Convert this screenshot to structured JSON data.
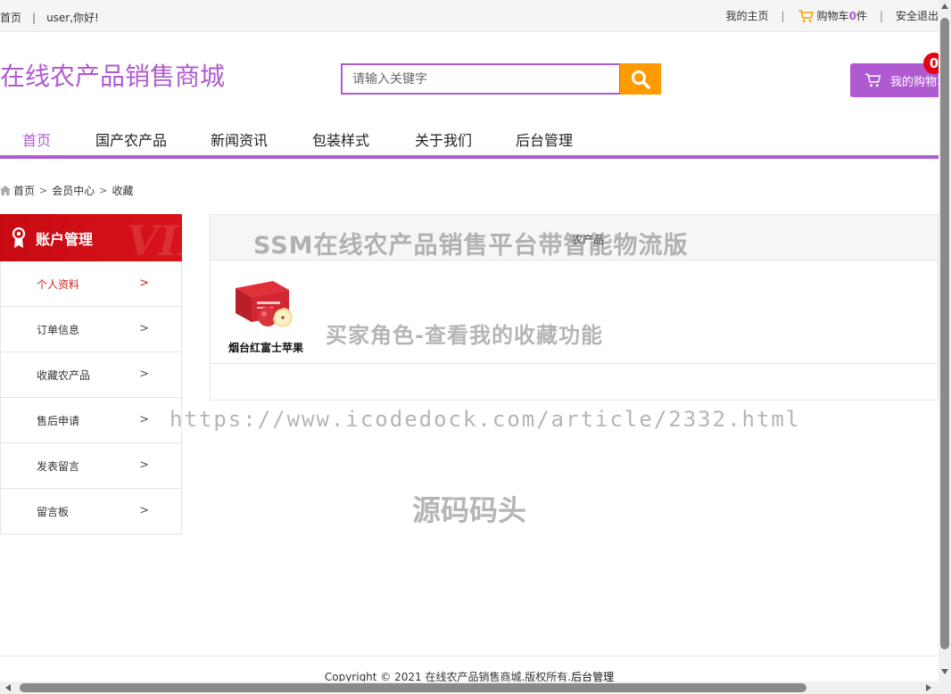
{
  "topbar": {
    "home_link": "首页",
    "greeting": "user,你好!",
    "my_home": "我的主页",
    "cart_label": "购物车",
    "cart_count": "0",
    "cart_unit": "件",
    "logout": "安全退出"
  },
  "header": {
    "logo": "在线农产品销售商城",
    "search_placeholder": "请输入关键字",
    "cart_button": "我的购物车",
    "cart_badge": "0"
  },
  "nav": {
    "items": [
      "首页",
      "国产农产品",
      "新闻资讯",
      "包装样式",
      "关于我们",
      "后台管理"
    ],
    "active_index": 0
  },
  "breadcrumb": [
    "首页",
    "会员中心",
    "收藏"
  ],
  "sidebar": {
    "title": "账户管理",
    "decor": "VIP",
    "items": [
      "个人资料",
      "订单信息",
      "收藏农产品",
      "售后申请",
      "发表留言",
      "留言板"
    ],
    "active_index": 0
  },
  "main": {
    "tab": "农产品",
    "favorites": [
      {
        "name": "烟台红富士苹果",
        "image": "apple-box-image"
      }
    ]
  },
  "watermarks": {
    "line1": "SSM在线农产品销售平台带智能物流版",
    "line2": "买家角色-查看我的收藏功能",
    "line3": "https://www.icodedock.com/article/2332.html",
    "line4": "源码码头"
  },
  "footer": {
    "text": "Copyright © 2021 在线农产品销售商城.版权所有.",
    "admin_link": "后台管理"
  },
  "colors": {
    "brand_purple": "#b05ad1",
    "search_orange": "#ff9b00",
    "sidebar_red": "#d10d15",
    "badge_red": "#e60012"
  }
}
